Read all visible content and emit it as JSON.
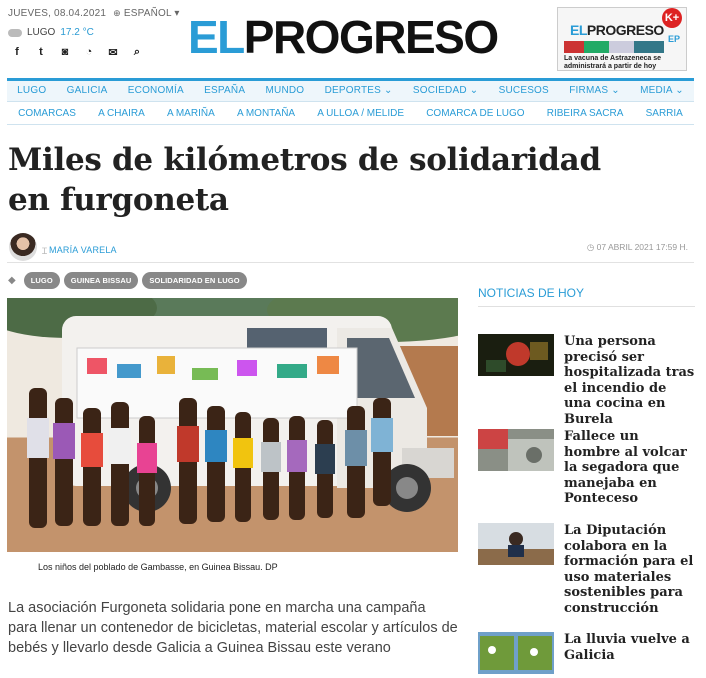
{
  "topbar": {
    "date": "JUEVES, 08.04.2021",
    "language": "ESPAÑOL",
    "weather_city": "LUGO",
    "weather_temp": "17.2 °C",
    "social_icons": [
      "facebook-icon",
      "twitter-icon",
      "instagram-icon",
      "rss-icon",
      "newsletter-icon",
      "search-icon"
    ]
  },
  "logo": {
    "part1": "EL",
    "part2": "PROGRESO"
  },
  "promo": {
    "logo_el": "EL",
    "logo_rest": "PROGRESO",
    "badge": "K+",
    "edition": "EP",
    "text": "La vacuna de Astrazeneca se administrará a partir de hoy"
  },
  "nav": {
    "items": [
      "LUGO",
      "GALICIA",
      "ECONOMÍA",
      "ESPAÑA",
      "MUNDO",
      "DEPORTES ⌄",
      "SOCIEDAD ⌄",
      "SUCESOS",
      "FIRMAS ⌄",
      "MEDIA ⌄"
    ],
    "subitems": [
      "COMARCAS",
      "A CHAIRA",
      "A MARIÑA",
      "A MONTAÑA",
      "A ULLOA / MELIDE",
      "COMARCA DE LUGO",
      "RIBEIRA SACRA",
      "SARRIA"
    ]
  },
  "article": {
    "title": "Miles de kilómetros de solidaridad en furgoneta",
    "author": "MARÍA VARELA",
    "timestamp": "07 ABRIL 2021 17:59 H.",
    "tags": [
      "LUGO",
      "GUINEA BISSAU",
      "SOLIDARIDAD EN LUGO"
    ],
    "caption": "Los niños del poblado de Gambasse, en Guinea Bissau. DP",
    "summary": "La asociación Furgoneta solidaria pone en marcha una campaña para llenar un contenedor de bicicletas, material escolar y artículos de bebés y llevarlo desde Galicia a Guinea Bissau este verano"
  },
  "sidebar": {
    "title": "NOTICIAS DE HOY",
    "stories": [
      {
        "title": "Una persona precisó ser hospitalizada tras el incendio de una cocina en Burela"
      },
      {
        "title": "Fallece un hombre al volcar la segadora que manejaba en Ponteceso"
      },
      {
        "title": "La Diputación colabora en la formación para el uso materiales sostenibles para construcción"
      },
      {
        "title": "La lluvia vuelve a Galicia"
      }
    ]
  },
  "colors": {
    "accent": "#2a9cd6",
    "text": "#222222"
  }
}
